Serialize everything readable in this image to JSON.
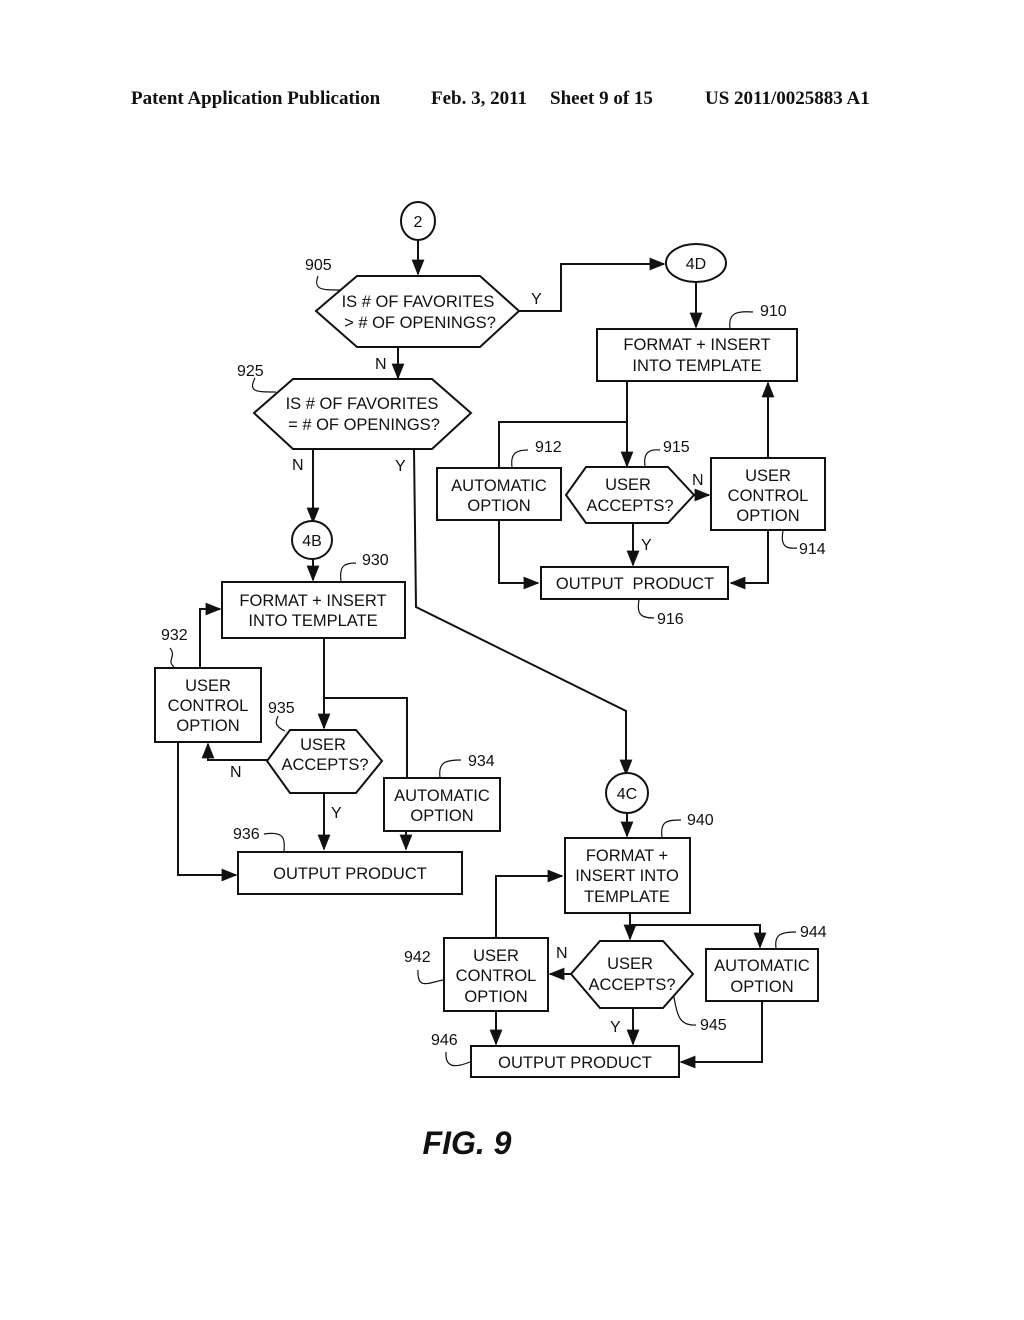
{
  "header": {
    "publication": "Patent Application Publication",
    "date": "Feb. 3, 2011",
    "sheet": "Sheet 9 of 15",
    "number": "US 2011/0025883 A1"
  },
  "figure_label": "FIG. 9",
  "connectors": {
    "start": "2",
    "c4d": "4D",
    "c4b": "4B",
    "c4c": "4C"
  },
  "decisions": {
    "d905": {
      "ref": "905",
      "line1": "IS # OF FAVORITES",
      "line2": "> # OF OPENINGS?",
      "yes": "Y",
      "no": "N"
    },
    "d925": {
      "ref": "925",
      "line1": "IS # OF FAVORITES",
      "line2": "= # OF OPENINGS?",
      "yes": "Y",
      "no": "N"
    },
    "d915": {
      "ref": "915",
      "line1": "USER",
      "line2": "ACCEPTS?",
      "yes": "Y",
      "no": "N"
    },
    "d935": {
      "ref": "935",
      "line1": "USER",
      "line2": "ACCEPTS?",
      "yes": "Y",
      "no": "N"
    },
    "d945": {
      "ref": "945",
      "line1": "USER",
      "line2": "ACCEPTS?",
      "yes": "Y",
      "no": "N"
    }
  },
  "branch_4d": {
    "format": {
      "ref": "910",
      "line1": "FORMAT + INSERT",
      "line2": "INTO TEMPLATE"
    },
    "automatic": {
      "ref": "912",
      "line1": "AUTOMATIC",
      "line2": "OPTION"
    },
    "user_control": {
      "ref": "914",
      "line1": "USER",
      "line2": "CONTROL",
      "line3": "OPTION"
    },
    "output": {
      "ref": "916",
      "label": "OUTPUT  PRODUCT"
    }
  },
  "branch_4b": {
    "format": {
      "ref": "930",
      "line1": "FORMAT + INSERT",
      "line2": "INTO TEMPLATE"
    },
    "user_control": {
      "ref": "932",
      "line1": "USER",
      "line2": "CONTROL",
      "line3": "OPTION"
    },
    "automatic": {
      "ref": "934",
      "line1": "AUTOMATIC",
      "line2": "OPTION"
    },
    "output": {
      "ref": "936",
      "label": "OUTPUT PRODUCT"
    }
  },
  "branch_4c": {
    "format": {
      "ref": "940",
      "line1": "FORMAT +",
      "line2": "INSERT INTO",
      "line3": "TEMPLATE"
    },
    "user_control": {
      "ref": "942",
      "line1": "USER",
      "line2": "CONTROL",
      "line3": "OPTION"
    },
    "automatic": {
      "ref": "944",
      "line1": "AUTOMATIC",
      "line2": "OPTION"
    },
    "output": {
      "ref": "946",
      "label": "OUTPUT PRODUCT"
    }
  }
}
